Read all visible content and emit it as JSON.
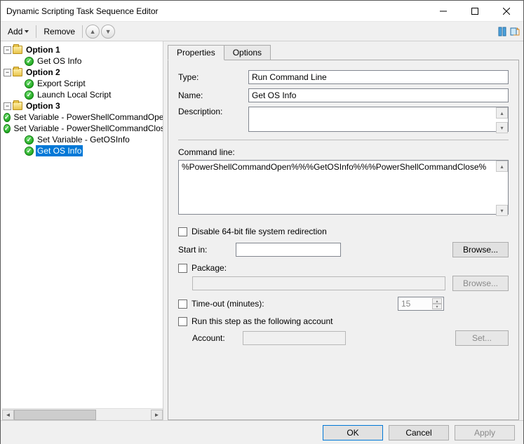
{
  "window": {
    "title": "Dynamic Scripting Task Sequence Editor"
  },
  "toolbar": {
    "add_label": "Add",
    "remove_label": "Remove"
  },
  "tree": {
    "option1": {
      "label": "Option 1",
      "items": [
        "Get OS Info"
      ]
    },
    "option2": {
      "label": "Option 2",
      "items": [
        "Export Script",
        "Launch Local Script"
      ]
    },
    "option3": {
      "label": "Option 3",
      "items": [
        "Set Variable - PowerShellCommandOpen",
        "Set Variable - PowerShellCommandClose",
        "Set Variable - GetOSInfo",
        "Get OS Info"
      ]
    },
    "selected": "Get OS Info"
  },
  "tabs": {
    "properties": "Properties",
    "options": "Options"
  },
  "form": {
    "type_label": "Type:",
    "type_value": "Run Command Line",
    "name_label": "Name:",
    "name_value": "Get OS Info",
    "description_label": "Description:",
    "description_value": "",
    "cmdline_label": "Command line:",
    "cmdline_value": "%PowerShellCommandOpen%%%GetOSInfo%%%PowerShellCommandClose%",
    "disable64_label": "Disable 64-bit file system redirection",
    "startin_label": "Start in:",
    "startin_value": "",
    "browse_label": "Browse...",
    "package_label": "Package:",
    "timeout_label": "Time-out (minutes):",
    "timeout_value": "15",
    "runas_label": "Run this step as the following account",
    "account_label": "Account:",
    "set_label": "Set..."
  },
  "footer": {
    "ok": "OK",
    "cancel": "Cancel",
    "apply": "Apply"
  }
}
